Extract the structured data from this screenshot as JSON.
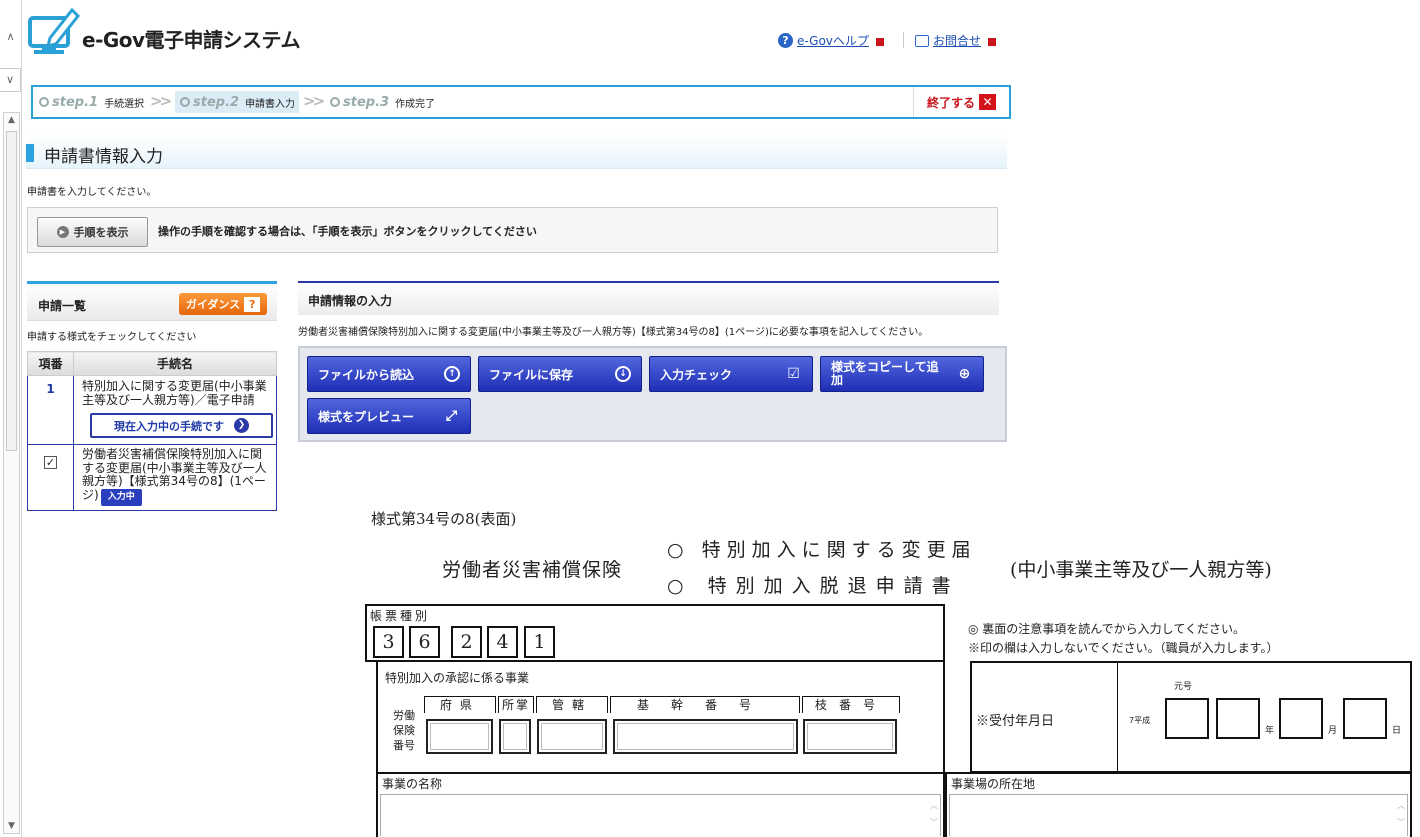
{
  "header": {
    "brand": "e-Gov電子申請システム",
    "help_link": "e-Govヘルプ",
    "contact_link": "お問合せ",
    "accent_color": "#29a1d6"
  },
  "steps": [
    {
      "num": "step.1",
      "label": "手続選択"
    },
    {
      "num": "step.2",
      "label": "申請書入力"
    },
    {
      "num": "step.3",
      "label": "作成完了"
    }
  ],
  "end_button": "終了する",
  "section_title": "申請書情報入力",
  "instruction": "申請書を入力してください。",
  "procedure": {
    "button": "手順を表示",
    "text": "操作の手順を確認する場合は、「手順を表示」ボタンをクリックしてください"
  },
  "left_panel": {
    "title": "申請一覧",
    "guidance": "ガイダンス",
    "note": "申請する様式をチェックしてください",
    "col_no": "項番",
    "col_name": "手続名",
    "row1_no": "1",
    "row1_name": "特別加入に関する変更届(中小事業主等及び一人親方等)／電子申請",
    "current_button": "現在入力中の手続です",
    "row2_name": "労働者災害補償保険特別加入に関する変更届(中小事業主等及び一人親方等)【様式第34号の8】(1ページ)",
    "row2_badge": "入力中"
  },
  "right_panel": {
    "title": "申請情報の入力",
    "desc": "労働者災害補償保険特別加入に関する変更届(中小事業主等及び一人親方等)【様式第34号の8】(1ページ)に必要な事項を記入してください。",
    "buttons": {
      "load": "ファイルから読込",
      "save": "ファイルに保存",
      "check": "入力チェック",
      "copy": "様式をコピーして追加",
      "preview": "様式をプレビュー"
    }
  },
  "form": {
    "title": "様式第34号の8(表面)",
    "insurance": "労働者災害補償保険",
    "option1": "○ 特別加入に関する変更届",
    "option2": "○ 特別加入脱退申請書",
    "category": "(中小事業主等及び一人親方等)",
    "chohyo_label": "帳票種別",
    "digits": [
      "3",
      "6",
      "2",
      "4",
      "1"
    ],
    "note1": "◎ 裏面の注意事項を読んでから入力してください。",
    "note2": "※印の欄は入力しないでください。（職員が入力します。）",
    "jigyo_label": "特別加入の承認に係る事業",
    "rodo_label": "労働保険番号",
    "sub_pref": "府県",
    "sub_shoshou": "所掌",
    "sub_kankatsu": "管轄",
    "sub_kikan": "基幹番号",
    "sub_eda": "枝番号",
    "uketsuke_label": "※受付年月日",
    "gengo_top": "元号",
    "gengo_heisei": "7平成",
    "year": "年",
    "month": "月",
    "day": "日",
    "business_name": "事業の名称",
    "business_addr": "事業場の所在地"
  }
}
